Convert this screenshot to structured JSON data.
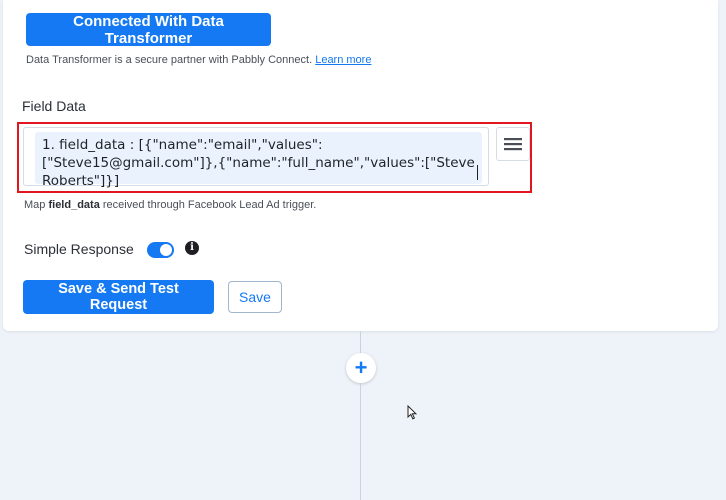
{
  "integration": {
    "connected_button": "Connected With Data Transformer",
    "partner_note": "Data Transformer is a secure partner with Pabbly Connect.",
    "learn_more": "Learn more"
  },
  "field": {
    "label": "Field Data",
    "value": "1. field_data : [{\"name\":\"email\",\"values\":[\"Steve15@gmail.com\"]},{\"name\":\"full_name\",\"values\":[\"Steve Roberts\"]}]",
    "hint_prefix": "Map",
    "hint_field": "field_data",
    "hint_suffix": "received through Facebook Lead Ad trigger."
  },
  "simple_response": {
    "label": "Simple Response",
    "enabled": true
  },
  "actions": {
    "save_send": "Save & Send Test Request",
    "save": "Save"
  },
  "icons": {
    "menu": "hamburger-menu-icon",
    "info": "info-circle-icon",
    "add": "plus-icon"
  },
  "colors": {
    "primary": "#1479f2",
    "highlight_border": "#e0171f"
  }
}
